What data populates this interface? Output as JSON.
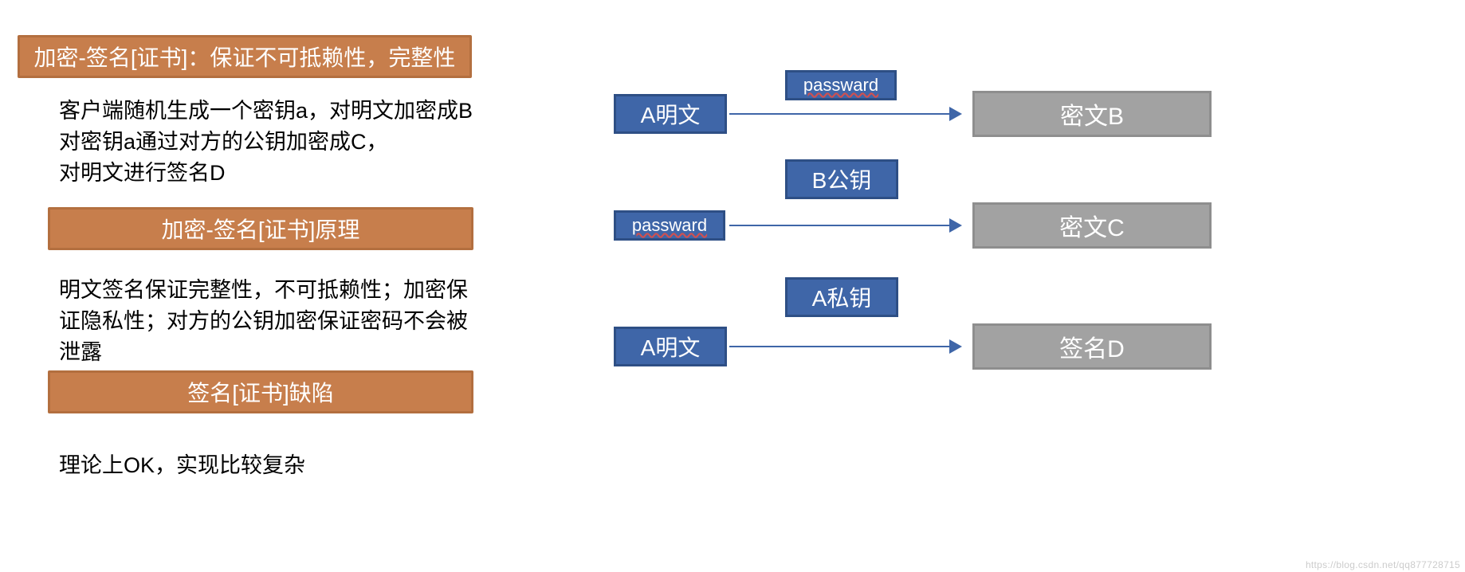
{
  "left": {
    "header1": "加密-签名[证书]：保证不可抵赖性，完整性",
    "paragraph1_line1": "客户端随机生成一个密钥a，对明文加密成B",
    "paragraph1_line2": "对密钥a通过对方的公钥加密成C，",
    "paragraph1_line3": "对明文进行签名D",
    "header2": "加密-签名[证书]原理",
    "paragraph2_line1": "明文签名保证完整性，不可抵赖性；加密保",
    "paragraph2_line2": "证隐私性；对方的公钥加密保证密码不会被",
    "paragraph2_line3": "泄露",
    "header3": "签名[证书]缺陷",
    "paragraph3": "理论上OK，实现比较复杂"
  },
  "diagram": {
    "row1": {
      "left": "A明文",
      "mid": "passward",
      "right": "密文B"
    },
    "row2": {
      "left": "passward",
      "mid": "B公钥",
      "right": "密文C"
    },
    "row3": {
      "left": "A明文",
      "mid": "A私钥",
      "right": "签名D"
    }
  },
  "watermark": "https://blog.csdn.net/qq877728715"
}
